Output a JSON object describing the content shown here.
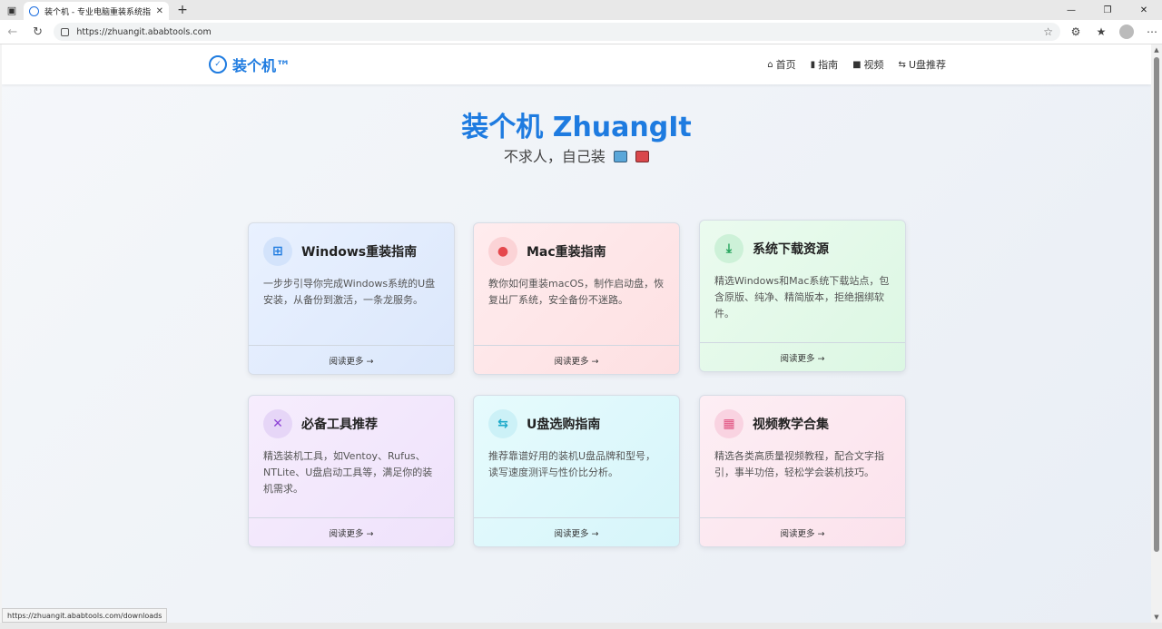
{
  "browser": {
    "tab_title": "装个机 - 专业电脑重装系统指南教",
    "tab_close": "✕",
    "new_tab": "+",
    "url": "https://zhuangit.ababtools.com",
    "status_url": "https://zhuangit.ababtools.com/downloads"
  },
  "site": {
    "logo_text": "装个机™",
    "nav": [
      {
        "icon": "home-icon",
        "glyph": "⌂",
        "label": "首页"
      },
      {
        "icon": "book-icon",
        "glyph": "▮",
        "label": "指南"
      },
      {
        "icon": "video-icon",
        "glyph": "■",
        "label": "视频"
      },
      {
        "icon": "usb-icon",
        "glyph": "⇆",
        "label": "U盘推荐"
      }
    ],
    "hero_title": "装个机 ZhuangIt",
    "hero_subtitle": "不求人，自己装",
    "read_more": "阅读更多 →"
  },
  "cards": [
    {
      "title": "Windows重装指南",
      "desc": "一步步引导你完成Windows系统的U盘安装，从备份到激活，一条龙服务。",
      "icon": "windows-icon",
      "glyph": "⊞",
      "icon_color": "#1e7be0",
      "icon_bg": "#d3e3fb"
    },
    {
      "title": "Mac重装指南",
      "desc": "教你如何重装macOS，制作启动盘，恢复出厂系统，安全备份不迷路。",
      "icon": "apple-icon",
      "glyph": "●",
      "icon_color": "#e5484d",
      "icon_bg": "#fbd3d6"
    },
    {
      "title": "系统下载资源",
      "desc": "精选Windows和Mac系统下载站点，包含原版、纯净、精简版本，拒绝捆绑软件。",
      "icon": "download-icon",
      "glyph": "⤓",
      "icon_color": "#22a35a",
      "icon_bg": "#cdf1d8"
    },
    {
      "title": "必备工具推荐",
      "desc": "精选装机工具，如Ventoy、Rufus、NTLite、U盘启动工具等，满足你的装机需求。",
      "icon": "tools-icon",
      "glyph": "✕",
      "icon_color": "#8e44d6",
      "icon_bg": "#e6d6f7"
    },
    {
      "title": "U盘选购指南",
      "desc": "推荐靠谱好用的装机U盘品牌和型号，读写速度测评与性价比分析。",
      "icon": "usb-icon",
      "glyph": "⇆",
      "icon_color": "#1ca9c9",
      "icon_bg": "#ccf1f7"
    },
    {
      "title": "视频教学合集",
      "desc": "精选各类高质量视频教程，配合文字指引，事半功倍，轻松学会装机技巧。",
      "icon": "film-icon",
      "glyph": "▦",
      "icon_color": "#e0507f",
      "icon_bg": "#f9d3e1"
    }
  ]
}
